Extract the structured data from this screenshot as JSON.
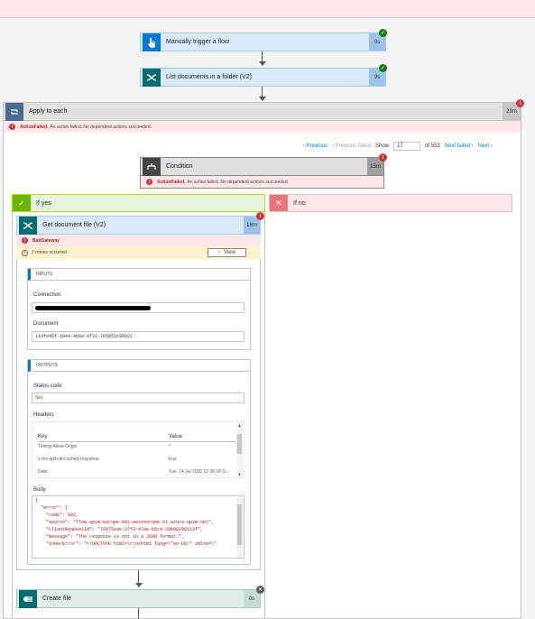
{
  "trigger": {
    "title": "Manually trigger a flow",
    "duration": "0s"
  },
  "list_docs": {
    "title": "List documents in a folder (V2)",
    "duration": "9s"
  },
  "apply_each": {
    "title": "Apply to each",
    "duration": "29m",
    "error_label": "ActionFailed.",
    "error_text": "An action failed. No dependent actions succeeded."
  },
  "pager": {
    "previous": "Previous",
    "previous_failed": "Previous failed",
    "show": "Show",
    "value": "17",
    "of": "of 553",
    "next_failed": "Next failed",
    "next": "Next"
  },
  "condition": {
    "title": "Condition",
    "duration": "15m",
    "error_label": "ActionFailed.",
    "error_text": "An action failed. No dependent actions succeeded."
  },
  "if_yes": "If yes",
  "if_no": "If no",
  "get_doc": {
    "title": "Get document file (V2)",
    "duration": "18m",
    "error": "BadGateway",
    "retries": "2 retries occurred.",
    "view": "View"
  },
  "inputs": {
    "header": "INPUTS",
    "connection_label": "Connection",
    "document_label": "Document",
    "document_value": "11dfe45f-1944-4b6e-9f31-7e5051c96622"
  },
  "outputs": {
    "header": "OUTPUTS",
    "status_label": "Status code",
    "status_value": "502",
    "headers_label": "Headers",
    "key_col": "Key",
    "value_col": "Value",
    "rows": [
      {
        "key": "Timing-Allow-Origin",
        "value": "*"
      },
      {
        "key": "x-ms-apihub-cached-response",
        "value": "true"
      },
      {
        "key": "Date",
        "value": "Tue, 14 Jul 2020 12:36:18 G..."
      }
    ],
    "body_label": "Body",
    "body_lines": [
      "{",
      "  \"error\": {",
      "    \"code\": 502,",
      "    \"source\": \"flow-apim-europe-001-westeurope-01.azure-apim.net\",",
      "    \"clientRequestId\": \"76075e4e-37f3-47ae-b5c4-29b90298113f\",",
      "    \"message\": \"The response is not in a JSON format.\",",
      "    \"innerError\": \"<!DOCTYPE html>\\r\\n<html lang=\\\"en-US\\\" xmlns=\\\""
    ]
  },
  "create_file": {
    "title": "Create file",
    "duration": "0s"
  },
  "colors": {
    "card_blue": "#dbeaf9",
    "error_red": "#d13438",
    "success_green": "#107c10",
    "accent": "#0078d4"
  }
}
